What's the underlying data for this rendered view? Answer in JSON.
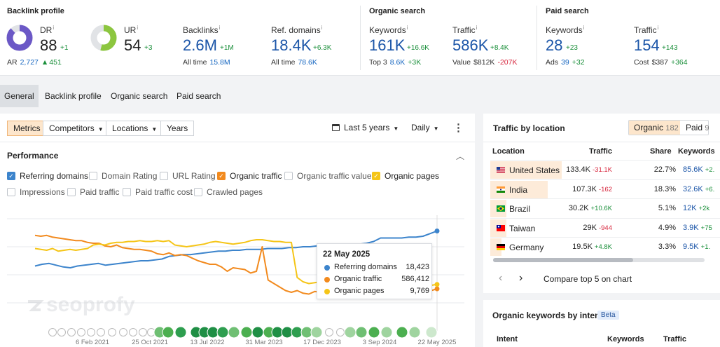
{
  "colors": {
    "accent_orange": "#f28a1e",
    "blue_line": "#3c84cc",
    "yellow_line": "#f5c518",
    "link_blue": "#1b55a8",
    "positive": "#1a8f3a",
    "negative": "#d7263d",
    "dr_purple": "#6b58c6",
    "ur_green": "#8cc63f"
  },
  "header": {
    "backlink_title": "Backlink profile",
    "organic_title": "Organic search",
    "paid_title": "Paid search",
    "info_mark": "i",
    "dr": {
      "label": "DR",
      "value": "88",
      "delta": "+1",
      "ar_label": "AR",
      "ar_value": "2,727",
      "ar_delta": "451",
      "gauge_fraction": 0.88
    },
    "ur": {
      "label": "UR",
      "value": "54",
      "delta": "+3",
      "gauge_fraction": 0.54
    },
    "backlinks": {
      "label": "Backlinks",
      "value": "2.6M",
      "delta": "+1M",
      "sub_label": "All time",
      "sub_value": "15.8M"
    },
    "ref_domains": {
      "label": "Ref. domains",
      "value": "18.4K",
      "delta": "+6.3K",
      "sub_label": "All time",
      "sub_value": "78.6K"
    },
    "keywords": {
      "label": "Keywords",
      "value": "161K",
      "delta": "+16.6K",
      "sub_label": "Top 3",
      "sub_value": "8.6K",
      "sub_delta": "+3K"
    },
    "traffic": {
      "label": "Traffic",
      "value": "586K",
      "delta": "+8.4K",
      "sub_label": "Value",
      "sub_value": "$812K",
      "sub_delta": "-207K"
    },
    "paid_keywords": {
      "label": "Keywords",
      "value": "28",
      "delta": "+23",
      "sub_label": "Ads",
      "sub_value": "39",
      "sub_delta": "+32"
    },
    "paid_traffic": {
      "label": "Traffic",
      "value": "154",
      "delta": "+143",
      "sub_label": "Cost",
      "sub_value": "$387",
      "sub_delta": "+364"
    }
  },
  "tabs": [
    "General",
    "Backlink profile",
    "Organic search",
    "Paid search"
  ],
  "toolbar": {
    "metrics": "Metrics",
    "competitors": "Competitors",
    "locations": "Locations",
    "years": "Years",
    "range": "Last 5 years",
    "interval": "Daily",
    "more": "⋮"
  },
  "performance": {
    "title": "Performance",
    "collapse": "︿",
    "checkboxes": [
      {
        "label": "Referring domains",
        "checked": true,
        "color": "#3c84cc"
      },
      {
        "label": "Domain Rating",
        "checked": false
      },
      {
        "label": "URL Rating",
        "checked": false
      },
      {
        "label": "Organic traffic",
        "checked": true,
        "color": "#f28a1e"
      },
      {
        "label": "Organic traffic value",
        "checked": false
      },
      {
        "label": "Organic pages",
        "checked": true,
        "color": "#f5c518"
      },
      {
        "label": "Impressions",
        "checked": false
      },
      {
        "label": "Paid traffic",
        "checked": false
      },
      {
        "label": "Paid traffic cost",
        "checked": false
      },
      {
        "label": "Crawled pages",
        "checked": false
      }
    ]
  },
  "chart_data": {
    "type": "line",
    "x_ticks": [
      "6 Feb 2021",
      "25 Oct 2021",
      "13 Jul 2022",
      "31 Mar 2023",
      "17 Dec 2023",
      "3 Sep 2024",
      "22 May 2025"
    ],
    "series": [
      {
        "name": "Referring domains",
        "color": "#3c84cc",
        "values": [
          0.42,
          0.4,
          0.39,
          0.41,
          0.43,
          0.44,
          0.42,
          0.41,
          0.4,
          0.39,
          0.41,
          0.4,
          0.39,
          0.38,
          0.37,
          0.36,
          0.36,
          0.35,
          0.34,
          0.31,
          0.3,
          0.29,
          0.29,
          0.28,
          0.27,
          0.26,
          0.25,
          0.25,
          0.24,
          0.24,
          0.23,
          0.23,
          0.23,
          0.22,
          0.22,
          0.22,
          0.21,
          0.21,
          0.2,
          0.2,
          0.19,
          0.19,
          0.19,
          0.18,
          0.18,
          0.17,
          0.17,
          0.16,
          0.14,
          0.1,
          0.1,
          0.1,
          0.1,
          0.09,
          0.09,
          0.08,
          0.05,
          0.02
        ]
      },
      {
        "name": "Organic traffic",
        "color": "#f28a1e",
        "values": [
          0.07,
          0.08,
          0.07,
          0.09,
          0.1,
          0.11,
          0.12,
          0.13,
          0.13,
          0.15,
          0.16,
          0.16,
          0.19,
          0.2,
          0.18,
          0.21,
          0.22,
          0.23,
          0.23,
          0.24,
          0.25,
          0.28,
          0.29,
          0.27,
          0.3,
          0.29,
          0.3,
          0.33,
          0.36,
          0.38,
          0.4,
          0.4,
          0.43,
          0.48,
          0.44,
          0.45,
          0.46,
          0.5,
          0.48,
          0.2,
          0.58,
          0.62,
          0.66,
          0.7,
          0.72,
          0.7,
          0.73,
          0.74,
          0.71,
          0.72,
          0.74,
          0.72,
          0.7,
          0.71,
          0.73,
          0.71,
          0.72,
          0.73,
          0.72,
          0.7,
          0.73,
          0.71,
          0.72,
          0.72,
          0.7,
          0.72,
          0.71,
          0.74,
          0.7,
          0.68
        ]
      },
      {
        "name": "Organic pages",
        "color": "#f5c518",
        "values": [
          0.22,
          0.23,
          0.24,
          0.22,
          0.25,
          0.24,
          0.23,
          0.24,
          0.23,
          0.22,
          0.18,
          0.17,
          0.18,
          0.16,
          0.15,
          0.15,
          0.14,
          0.14,
          0.13,
          0.14,
          0.14,
          0.13,
          0.14,
          0.13,
          0.18,
          0.19,
          0.2,
          0.19,
          0.18,
          0.17,
          0.15,
          0.14,
          0.15,
          0.16,
          0.17,
          0.16,
          0.15,
          0.13,
          0.12,
          0.12,
          0.13,
          0.14,
          0.14,
          0.15,
          0.15,
          0.55,
          0.6,
          0.62,
          0.61,
          0.6,
          0.61,
          0.6,
          0.59,
          0.58,
          0.6,
          0.61,
          0.62,
          0.63,
          0.62,
          0.63,
          0.64,
          0.65,
          0.62,
          0.65,
          0.66,
          0.64,
          0.66,
          0.65,
          0.64,
          0.63
        ]
      }
    ],
    "tooltip": {
      "date": "22 May 2025",
      "rows": [
        {
          "label": "Referring domains",
          "value": "18,423",
          "color": "#3c84cc"
        },
        {
          "label": "Organic traffic",
          "value": "586,412",
          "color": "#f28a1e"
        },
        {
          "label": "Organic pages",
          "value": "9,769",
          "color": "#f5c518"
        }
      ]
    },
    "grid": true
  },
  "watermark": "seoprofy",
  "traffic_by_location": {
    "title": "Traffic by location",
    "toggle_organic": "Organic",
    "toggle_organic_count": "182",
    "toggle_paid": "Paid",
    "toggle_paid_count": "9",
    "columns": [
      "Location",
      "Traffic",
      "Share",
      "Keywords"
    ],
    "rows": [
      {
        "country": "United States",
        "flag": "us",
        "traffic": "133.4K",
        "delta": "-31.1K",
        "delta_positive": false,
        "share": "22.7%",
        "share_fraction": 0.227,
        "keywords": "85.6K",
        "kw_delta": "+2.",
        "bar": 0.31
      },
      {
        "country": "India",
        "flag": "in",
        "traffic": "107.3K",
        "delta": "-162",
        "delta_positive": false,
        "share": "18.3%",
        "share_fraction": 0.183,
        "keywords": "32.6K",
        "kw_delta": "+6.",
        "bar": 0.25
      },
      {
        "country": "Brazil",
        "flag": "br",
        "traffic": "30.2K",
        "delta": "+10.6K",
        "delta_positive": true,
        "share": "5.1%",
        "share_fraction": 0.051,
        "keywords": "12K",
        "kw_delta": "+2k",
        "bar": 0.07
      },
      {
        "country": "Taiwan",
        "flag": "tw",
        "traffic": "29K",
        "delta": "-944",
        "delta_positive": false,
        "share": "4.9%",
        "share_fraction": 0.049,
        "keywords": "3.9K",
        "kw_delta": "+75",
        "bar": 0.07
      },
      {
        "country": "Germany",
        "flag": "de",
        "traffic": "19.5K",
        "delta": "+4.8K",
        "delta_positive": true,
        "share": "3.3%",
        "share_fraction": 0.033,
        "keywords": "9.5K",
        "kw_delta": "+1.",
        "bar": 0.05
      }
    ],
    "compare_label": "Compare top 5 on chart",
    "prev": "‹",
    "next": "›"
  },
  "intent": {
    "title": "Organic keywords by intent",
    "badge": "Beta",
    "columns": [
      "Intent",
      "Keywords",
      "Traffic"
    ]
  }
}
